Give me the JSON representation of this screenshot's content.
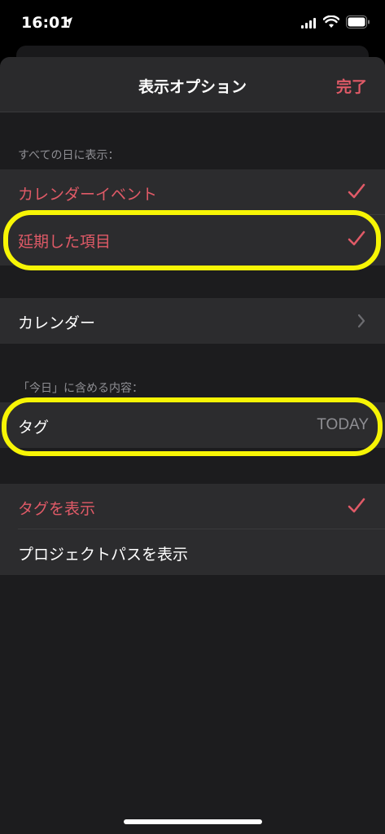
{
  "status_bar": {
    "time": "16:01",
    "icons": [
      "location-arrow-icon",
      "cellular-signal-icon",
      "wifi-icon",
      "battery-icon"
    ]
  },
  "nav": {
    "title": "表示オプション",
    "done": "完了"
  },
  "section_all_days": {
    "header": "すべての日に表示：",
    "items": [
      {
        "label": "カレンダーイベント",
        "checked": true
      },
      {
        "label": "延期した項目",
        "checked": true
      }
    ]
  },
  "calendar_row": {
    "label": "カレンダー",
    "icon": "chevron-right-icon"
  },
  "section_today": {
    "header": "「今日」に含める内容：",
    "tag_row": {
      "label": "タグ",
      "value": "TODAY"
    }
  },
  "section_display": {
    "items": [
      {
        "label": "タグを表示",
        "checked": true
      },
      {
        "label": "プロジェクトパスを表示",
        "checked": false
      }
    ]
  },
  "colors": {
    "accent": "#e05a67",
    "highlight": "#f7f505",
    "background": "#1c1c1e",
    "cell": "#2c2c2e"
  }
}
